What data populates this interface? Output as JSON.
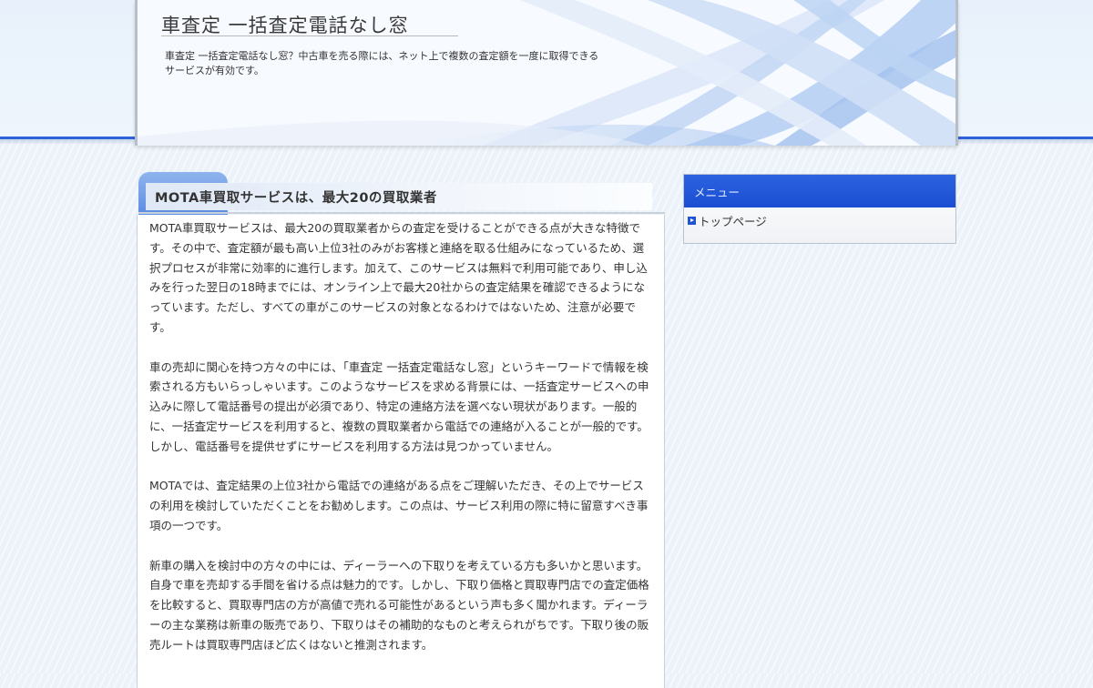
{
  "site": {
    "title": "車査定 一括査定電話なし窓",
    "description": "車査定 一括査定電話なし窓？中古車を売る際には、ネット上で複数の査定額を一度に取得できるサービスが有効です。"
  },
  "entry": {
    "title": "MOTA車買取サービスは、最大20の買取業者",
    "paragraphs": [
      "MOTA車買取サービスは、最大20の買取業者からの査定を受けることができる点が大きな特徴です。その中で、査定額が最も高い上位3社のみがお客様と連絡を取る仕組みになっているため、選択プロセスが非常に効率的に進行します。加えて、このサービスは無料で利用可能であり、申し込みを行った翌日の18時までには、オンライン上で最大20社からの査定結果を確認できるようになっています。ただし、すべての車がこのサービスの対象となるわけではないため、注意が必要です。",
      "車の売却に関心を持つ方々の中には、「車査定 一括査定電話なし窓」というキーワードで情報を検索される方もいらっしゃいます。このようなサービスを求める背景には、一括査定サービスへの申込みに際して電話番号の提出が必須であり、特定の連絡方法を選べない現状があります。一般的に、一括査定サービスを利用すると、複数の買取業者から電話での連絡が入ることが一般的です。しかし、電話番号を提供せずにサービスを利用する方法は見つかっていません。",
      "MOTAでは、査定結果の上位3社から電話での連絡がある点をご理解いただき、その上でサービスの利用を検討していただくことをお勧めします。この点は、サービス利用の際に特に留意すべき事項の一つです。",
      "新車の購入を検討中の方々の中には、ディーラーへの下取りを考えている方も多いかと思います。自身で車を売却する手間を省ける点は魅力的です。しかし、下取り価格と買取専門店での査定価格を比較すると、買取専門店の方が高値で売れる可能性があるという声も多く聞かれます。ディーラーの主な業務は新車の販売であり、下取りはその補助的なものと考えられがちです。下取り後の販売ルートは買取専門店ほど広くはないと推測されます。"
    ]
  },
  "sidebar": {
    "title": "メニュー",
    "items": [
      {
        "label": "トップページ"
      }
    ]
  },
  "colors": {
    "accent": "#2f61d8",
    "sidebar_header": "#1f55d4",
    "background": "#eef4fa"
  }
}
